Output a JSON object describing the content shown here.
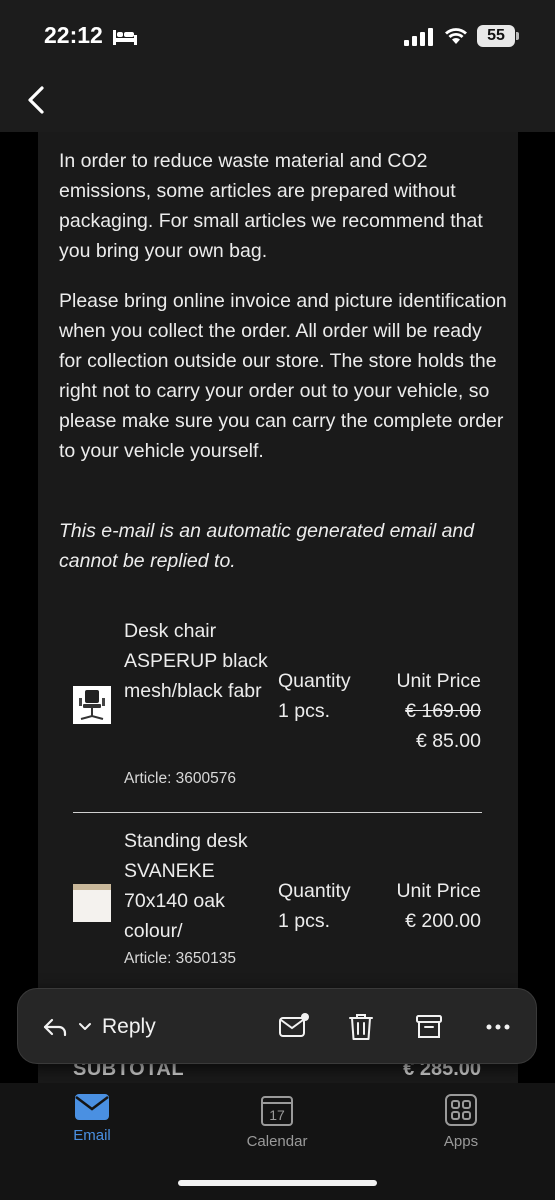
{
  "status": {
    "time": "22:12",
    "battery": "55"
  },
  "email": {
    "paragraphs": [
      "In order to reduce waste material and CO2 emissions, some articles are prepared without packaging. For small articles we recommend that you bring your own bag.",
      "Please bring online invoice and picture identification when you collect the order. All order will be ready for collection outside our store. The store holds the right not to carry your order out to your vehicle, so please make sure you can carry the complete order to your vehicle yourself.",
      "This e-mail is an automatic generated email and cannot be replied to."
    ],
    "items": [
      {
        "name": "Desk chair ASPERUP black mesh/black fabr",
        "article": "Article: 3600576",
        "quantity_label": "Quantity",
        "quantity": "1 pcs.",
        "price_label": "Unit Price",
        "price_old": "€ 169.00",
        "price": "€ 85.00"
      },
      {
        "name": "Standing desk SVANEKE 70x140 oak colour/",
        "article": "Article: 3650135",
        "quantity_label": "Quantity",
        "quantity": "1 pcs.",
        "price_label": "Unit Price",
        "price": "€ 200.00"
      }
    ],
    "subtotal_label": "SUBTOTAL",
    "subtotal_value": "€ 285.00"
  },
  "actions": {
    "reply_label": "Reply"
  },
  "tabs": [
    {
      "label": "Email",
      "active": true
    },
    {
      "label": "Calendar",
      "icon_text": "17"
    },
    {
      "label": "Apps"
    }
  ],
  "colors": {
    "accent": "#4a90e2",
    "background": "#000000",
    "card": "#1a1a1a"
  }
}
